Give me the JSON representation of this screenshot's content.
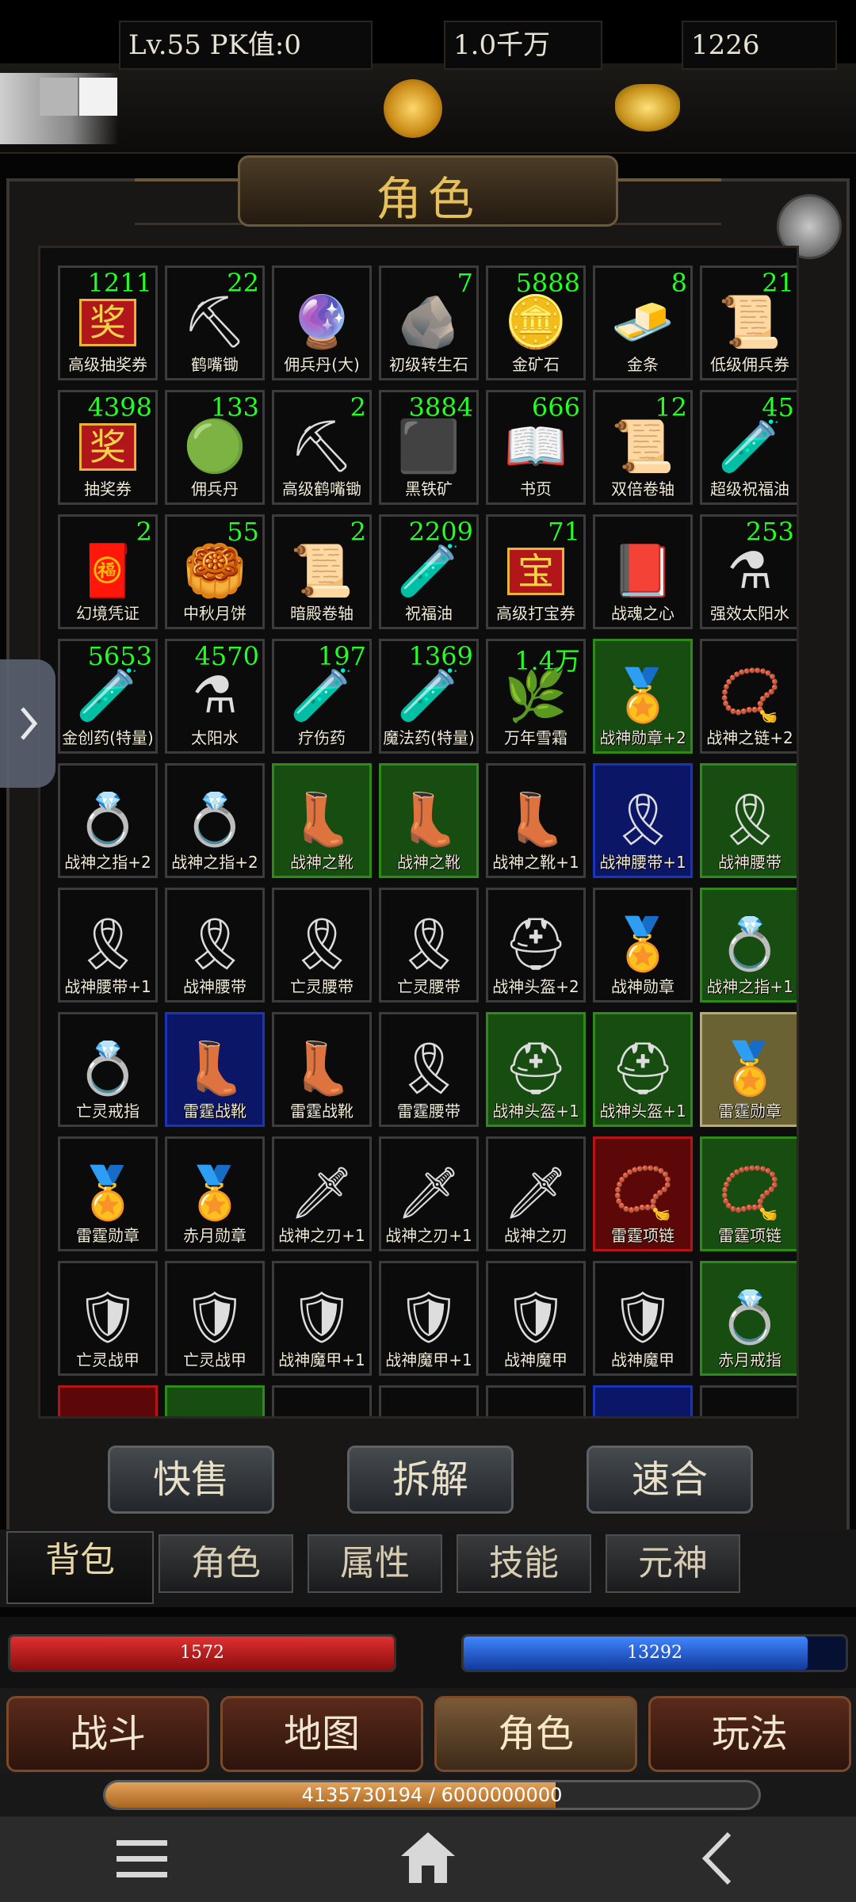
{
  "header": {
    "level_text": "Lv.55 PK值:0",
    "gold_text": "1.0千万",
    "ingot_text": "1226"
  },
  "title": "角色",
  "items": [
    {
      "name": "高级抽奖券",
      "count": "1211",
      "icon": "奖",
      "rarity": "none"
    },
    {
      "name": "鹤嘴锄",
      "count": "22",
      "icon": "⛏",
      "rarity": "none"
    },
    {
      "name": "佣兵丹(大)",
      "count": "",
      "icon": "🔮",
      "rarity": "none"
    },
    {
      "name": "初级转生石",
      "count": "7",
      "icon": "🪨",
      "rarity": "none"
    },
    {
      "name": "金矿石",
      "count": "5888",
      "icon": "🪙",
      "rarity": "none"
    },
    {
      "name": "金条",
      "count": "8",
      "icon": "🧈",
      "rarity": "none"
    },
    {
      "name": "低级佣兵券",
      "count": "21",
      "icon": "📜",
      "rarity": "none"
    },
    {
      "name": "抽奖券",
      "count": "4398",
      "icon": "奖",
      "rarity": "none"
    },
    {
      "name": "佣兵丹",
      "count": "133",
      "icon": "🟢",
      "rarity": "none"
    },
    {
      "name": "高级鹤嘴锄",
      "count": "2",
      "icon": "⛏",
      "rarity": "none"
    },
    {
      "name": "黑铁矿",
      "count": "3884",
      "icon": "⬛",
      "rarity": "none"
    },
    {
      "name": "书页",
      "count": "666",
      "icon": "📖",
      "rarity": "none"
    },
    {
      "name": "双倍卷轴",
      "count": "12",
      "icon": "📜",
      "rarity": "none"
    },
    {
      "name": "超级祝福油",
      "count": "45",
      "icon": "🧪",
      "rarity": "none"
    },
    {
      "name": "幻境凭证",
      "count": "2",
      "icon": "🧧",
      "rarity": "none"
    },
    {
      "name": "中秋月饼",
      "count": "55",
      "icon": "🥮",
      "rarity": "none"
    },
    {
      "name": "暗殿卷轴",
      "count": "2",
      "icon": "📜",
      "rarity": "none"
    },
    {
      "name": "祝福油",
      "count": "2209",
      "icon": "🧪",
      "rarity": "none"
    },
    {
      "name": "高级打宝券",
      "count": "71",
      "icon": "宝",
      "rarity": "none"
    },
    {
      "name": "战魂之心",
      "count": "",
      "icon": "📕",
      "rarity": "none"
    },
    {
      "name": "强效太阳水",
      "count": "253",
      "icon": "⚗",
      "rarity": "none"
    },
    {
      "name": "金创药(特量)",
      "count": "5653",
      "icon": "🧪",
      "rarity": "none"
    },
    {
      "name": "太阳水",
      "count": "4570",
      "icon": "⚗",
      "rarity": "none"
    },
    {
      "name": "疗伤药",
      "count": "197",
      "icon": "🧪",
      "rarity": "none"
    },
    {
      "name": "魔法药(特量)",
      "count": "1369",
      "icon": "🧪",
      "rarity": "none"
    },
    {
      "name": "万年雪霜",
      "count": "1.4万",
      "icon": "🌿",
      "rarity": "none"
    },
    {
      "name": "战神勋章+2",
      "count": "",
      "icon": "🏅",
      "rarity": "green"
    },
    {
      "name": "战神之链+2",
      "count": "",
      "icon": "📿",
      "rarity": "none"
    },
    {
      "name": "战神之指+2",
      "count": "",
      "icon": "💍",
      "rarity": "none"
    },
    {
      "name": "战神之指+2",
      "count": "",
      "icon": "💍",
      "rarity": "none"
    },
    {
      "name": "战神之靴",
      "count": "",
      "icon": "👢",
      "rarity": "green"
    },
    {
      "name": "战神之靴",
      "count": "",
      "icon": "👢",
      "rarity": "green"
    },
    {
      "name": "战神之靴+1",
      "count": "",
      "icon": "👢",
      "rarity": "none"
    },
    {
      "name": "战神腰带+1",
      "count": "",
      "icon": "🎗",
      "rarity": "blue"
    },
    {
      "name": "战神腰带",
      "count": "",
      "icon": "🎗",
      "rarity": "green"
    },
    {
      "name": "战神腰带+1",
      "count": "",
      "icon": "🎗",
      "rarity": "none"
    },
    {
      "name": "战神腰带",
      "count": "",
      "icon": "🎗",
      "rarity": "none"
    },
    {
      "name": "亡灵腰带",
      "count": "",
      "icon": "🎗",
      "rarity": "none"
    },
    {
      "name": "亡灵腰带",
      "count": "",
      "icon": "🎗",
      "rarity": "none"
    },
    {
      "name": "战神头盔+2",
      "count": "",
      "icon": "⛑",
      "rarity": "none"
    },
    {
      "name": "战神勋章",
      "count": "",
      "icon": "🏅",
      "rarity": "none"
    },
    {
      "name": "战神之指+1",
      "count": "",
      "icon": "💍",
      "rarity": "green"
    },
    {
      "name": "亡灵戒指",
      "count": "",
      "icon": "💍",
      "rarity": "none"
    },
    {
      "name": "雷霆战靴",
      "count": "",
      "icon": "👢",
      "rarity": "blue"
    },
    {
      "name": "雷霆战靴",
      "count": "",
      "icon": "👢",
      "rarity": "none"
    },
    {
      "name": "雷霆腰带",
      "count": "",
      "icon": "🎗",
      "rarity": "none"
    },
    {
      "name": "战神头盔+1",
      "count": "",
      "icon": "⛑",
      "rarity": "green"
    },
    {
      "name": "战神头盔+1",
      "count": "",
      "icon": "⛑",
      "rarity": "green"
    },
    {
      "name": "雷霆勋章",
      "count": "",
      "icon": "🏅",
      "rarity": "gold"
    },
    {
      "name": "雷霆勋章",
      "count": "",
      "icon": "🏅",
      "rarity": "none"
    },
    {
      "name": "赤月勋章",
      "count": "",
      "icon": "🏅",
      "rarity": "none"
    },
    {
      "name": "战神之刃+1",
      "count": "",
      "icon": "🗡",
      "rarity": "none"
    },
    {
      "name": "战神之刃+1",
      "count": "",
      "icon": "🗡",
      "rarity": "none"
    },
    {
      "name": "战神之刃",
      "count": "",
      "icon": "🗡",
      "rarity": "none"
    },
    {
      "name": "雷霆项链",
      "count": "",
      "icon": "📿",
      "rarity": "red"
    },
    {
      "name": "雷霆项链",
      "count": "",
      "icon": "📿",
      "rarity": "green"
    },
    {
      "name": "亡灵战甲",
      "count": "",
      "icon": "🛡",
      "rarity": "none"
    },
    {
      "name": "亡灵战甲",
      "count": "",
      "icon": "🛡",
      "rarity": "none"
    },
    {
      "name": "战神魔甲+1",
      "count": "",
      "icon": "🛡",
      "rarity": "none"
    },
    {
      "name": "战神魔甲+1",
      "count": "",
      "icon": "🛡",
      "rarity": "none"
    },
    {
      "name": "战神魔甲",
      "count": "",
      "icon": "🛡",
      "rarity": "none"
    },
    {
      "name": "战神魔甲",
      "count": "",
      "icon": "🛡",
      "rarity": "none"
    },
    {
      "name": "赤月戒指",
      "count": "",
      "icon": "💍",
      "rarity": "green"
    },
    {
      "name": "",
      "count": "",
      "icon": "",
      "rarity": "red"
    },
    {
      "name": "",
      "count": "",
      "icon": "",
      "rarity": "green"
    },
    {
      "name": "",
      "count": "",
      "icon": "",
      "rarity": "none"
    },
    {
      "name": "",
      "count": "",
      "icon": "",
      "rarity": "none"
    },
    {
      "name": "",
      "count": "",
      "icon": "",
      "rarity": "none"
    },
    {
      "name": "",
      "count": "",
      "icon": "",
      "rarity": "blue"
    },
    {
      "name": "",
      "count": "",
      "icon": "",
      "rarity": "none"
    }
  ],
  "actions": {
    "quick_sell": "快售",
    "dismantle": "拆解",
    "merge": "速合"
  },
  "tabs": [
    "背包",
    "角色",
    "属性",
    "技能",
    "元神"
  ],
  "stats": {
    "hp": "1572",
    "mp": "13292",
    "hp_fraction": 1.0,
    "mp_fraction": 0.9
  },
  "nav": [
    "战斗",
    "地图",
    "角色",
    "玩法"
  ],
  "exp": {
    "text": "4135730194 / 6000000000",
    "fraction": 0.689
  },
  "icons": {
    "gold": "gold-coin-icon",
    "ingot": "gold-ingot-icon",
    "menu": "menu-icon",
    "home": "home-icon",
    "back": "back-icon",
    "side": "chevron-right-icon"
  },
  "colors": {
    "count_green": "#22ff22",
    "title_gold": "#e7c05b",
    "hp_red": "#c41a1a",
    "mp_blue": "#1a58c4"
  }
}
